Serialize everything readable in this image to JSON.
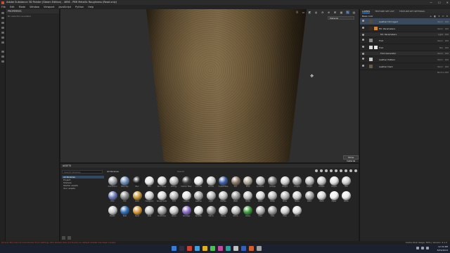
{
  "window": {
    "title": "Adobe Substance 3D Painter (Steam Edition) - 4656 - PBR Metallic Roughness (Read only)",
    "controls": [
      "—",
      "☐",
      "✕"
    ]
  },
  "menu": [
    "File",
    "Edit",
    "Mode",
    "Window",
    "Viewport",
    "JavaScript",
    "Python",
    "Help"
  ],
  "properties": {
    "title": "PROPERTIES",
    "subtitle": "No selection available"
  },
  "viewport": {
    "toolbar_icons": [
      "II",
      "▭",
      "◩",
      "◍",
      "◔",
      "⊕",
      "⌘",
      "▦",
      "✎",
      "▤"
    ],
    "view_select": "Material",
    "tooltip": "Show material"
  },
  "layers": {
    "tabs": [
      "LAYERS",
      "TEXTURE SET LIST",
      "TEXTURE SET SETTINGS"
    ],
    "toolbar_label": "Base color",
    "items": [
      {
        "name": "Leather Dirt Aged",
        "blend": "Norm",
        "opacity": "100",
        "selected": true
      },
      {
        "name": "Fill: Parameters",
        "blend": "Norm",
        "opacity": "100",
        "effect": false
      },
      {
        "name": "Fill: Parameters",
        "blend": "Light",
        "opacity": "100",
        "effect": true
      },
      {
        "name": "Fold",
        "blend": "Norm",
        "opacity": "100"
      },
      {
        "name": "Fold",
        "blend": "Mul",
        "opacity": "100"
      },
      {
        "name": "Fold Generator",
        "blend": "Norm",
        "opacity": "100",
        "effect": true
      },
      {
        "name": "Leather Pattern",
        "blend": "Norm",
        "opacity": "100"
      },
      {
        "name": "Leather Dark",
        "blend": "Norm",
        "opacity": "100"
      }
    ],
    "footer": "Norm ▾ 100"
  },
  "assets": {
    "title": "ASSETS",
    "search_placeholder": "Search libraries",
    "libraries": [
      "All libraries",
      "Project",
      "Shelves",
      "Starter assets",
      "Your assets"
    ],
    "breadcrumb": "All libraries",
    "search_label": "Search",
    "items": [
      {
        "label": "Aluminium",
        "color": "#9fa4a8"
      },
      {
        "label": "Blue Sky",
        "color": "#6f8fb8"
      },
      {
        "label": "Blur",
        "color": "#202020"
      },
      {
        "label": "Blur",
        "color": "#e6e6e6"
      },
      {
        "label": "Blur Slope",
        "color": "#d8d8d8"
      },
      {
        "label": "Bumpy",
        "color": "#b9b9b9"
      },
      {
        "label": "Carbon Fiber",
        "color": "#3a3a3a"
      },
      {
        "label": "Checker",
        "color": "#e8e8e8"
      },
      {
        "label": "Clouds",
        "color": "#c8c8c8"
      },
      {
        "label": "Cobalt Blue",
        "color": "#3d5fa8"
      },
      {
        "label": "Dirt",
        "color": "#8a7a66"
      },
      {
        "label": "Dust",
        "color": "#b0a898"
      },
      {
        "label": "Gradient",
        "color": "#bdbdbd"
      },
      {
        "label": "Grunge",
        "color": "#7a7a7a"
      },
      {
        "label": "Height",
        "color": "#d0d0d0"
      },
      {
        "label": "Height",
        "color": "#a0a0a0"
      },
      {
        "label": "Height",
        "color": "#b8b8b8"
      },
      {
        "label": "Height",
        "color": "#c8c8c8"
      },
      {
        "label": "Height",
        "color": "#e0e0e0"
      },
      {
        "label": "Hex",
        "color": "#d0d0d0"
      },
      {
        "label": "Holo",
        "color": "#6a7ab8"
      },
      {
        "label": "Iron",
        "color": "#8a8a8a"
      },
      {
        "label": "Gold",
        "color": "#c89a3a"
      },
      {
        "label": "Hologram",
        "color": "#cfcfcf"
      },
      {
        "label": "Honeycomb",
        "color": "#d8d8d8"
      },
      {
        "label": "Knit",
        "color": "#b8b8b8"
      },
      {
        "label": "Leather",
        "color": "#e4e4e4"
      },
      {
        "label": "Leather",
        "color": "#a9a9a9"
      },
      {
        "label": "Light",
        "color": "#bababa"
      },
      {
        "label": "Marble",
        "color": "#c0c0c0"
      },
      {
        "label": "Mesh",
        "color": "#9a9a9a"
      },
      {
        "label": "Metal",
        "color": "#c2c2c2"
      },
      {
        "label": "Metal",
        "color": "#d8d8d8"
      },
      {
        "label": "Metal",
        "color": "#bcbcbc"
      },
      {
        "label": "Moss",
        "color": "#b6b6b6"
      },
      {
        "label": "Noise",
        "color": "#cfcfcf"
      },
      {
        "label": "Paint",
        "color": "#a4a4a4"
      },
      {
        "label": "Paint",
        "color": "#d6d6d6"
      },
      {
        "label": "Paper",
        "color": "#f0f0f0"
      },
      {
        "label": "Perlin",
        "color": "#ebebeb"
      },
      {
        "label": "Plastic",
        "color": "#c9c9c9"
      },
      {
        "label": "Rust",
        "color": "#2f6fb8"
      },
      {
        "label": "Sand",
        "color": "#d89a3a"
      },
      {
        "label": "Rust",
        "color": "#c4c4c4"
      },
      {
        "label": "Scratches",
        "color": "#a0a0a0"
      },
      {
        "label": "Silver",
        "color": "#c8c8c8"
      },
      {
        "label": "Smudge",
        "color": "#8a6ac8"
      },
      {
        "label": "Splatter",
        "color": "#e0e0e0"
      },
      {
        "label": "Stains",
        "color": "#8e8e8e"
      },
      {
        "label": "Stone",
        "color": "#c8c8c8"
      },
      {
        "label": "Stone",
        "color": "#bdbdbd"
      },
      {
        "label": "Grass",
        "color": "#3a9a3a"
      },
      {
        "label": "Tiles",
        "color": "#b4b4b4"
      },
      {
        "label": "Tiles",
        "color": "#9c9c9c"
      },
      {
        "label": "Tiles",
        "color": "#d0d0d0"
      },
      {
        "label": "Wood",
        "color": "#dcdcdc"
      }
    ]
  },
  "status": {
    "message": "[Scene 3D] Cannot load shader from settings (the shader was not found) so default shader has been loaded",
    "right": "Cache Disk Usage: 69% | Version: 9.1.2"
  },
  "taskbar": {
    "icons": [
      "#3a7bd5",
      "#2f2f3f",
      "#d04030",
      "#3fa0e0",
      "#e0b020",
      "#4fc04f",
      "#c04a9a",
      "#2fa0a0",
      "#c0c0c0",
      "#3060c0",
      "#d06030",
      "#a0a0a0"
    ],
    "time": "12:34 PM",
    "date": "8/29/2024"
  }
}
